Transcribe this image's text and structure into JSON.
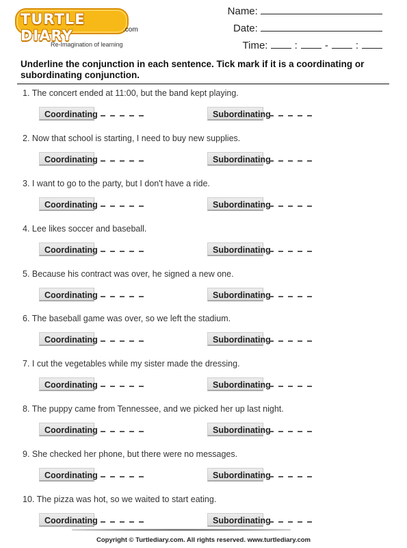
{
  "brand": {
    "logo_text": "TURTLE DIARY",
    "domain_suffix": ".com",
    "tagline": "Re-Imagination of learning"
  },
  "header_fields": {
    "name_label": "Name:",
    "date_label": "Date:",
    "time_label": "Time:",
    "time_colon": ":",
    "time_dash": "-"
  },
  "instructions": "Underline the conjunction in each sentence. Tick mark if it is a coordinating or subordinating conjunction.",
  "options": {
    "coordinating": "Coordinating",
    "subordinating": "Subordinating"
  },
  "questions": [
    {
      "number": "1.",
      "text": "The concert ended at 11:00, but the band kept playing."
    },
    {
      "number": "2.",
      "text": "Now that school is starting, I need to buy new supplies."
    },
    {
      "number": "3.",
      "text": "I want to go to the party, but I don't have a ride."
    },
    {
      "number": "4.",
      "text": "Lee likes soccer and baseball."
    },
    {
      "number": "5.",
      "text": "Because his contract was over, he signed a new one."
    },
    {
      "number": "6.",
      "text": "The baseball game was over, so we left the stadium."
    },
    {
      "number": "7.",
      "text": "I cut the vegetables while my sister made the dressing."
    },
    {
      "number": "8.",
      "text": "The puppy came from Tennessee, and we picked her up last night."
    },
    {
      "number": "9.",
      "text": "She checked her phone, but there were no messages."
    },
    {
      "number": "10.",
      "text": "The pizza was hot, so we waited to start eating."
    }
  ],
  "footer": "Copyright © Turtlediary.com. All rights reserved. www.turtlediary.com"
}
